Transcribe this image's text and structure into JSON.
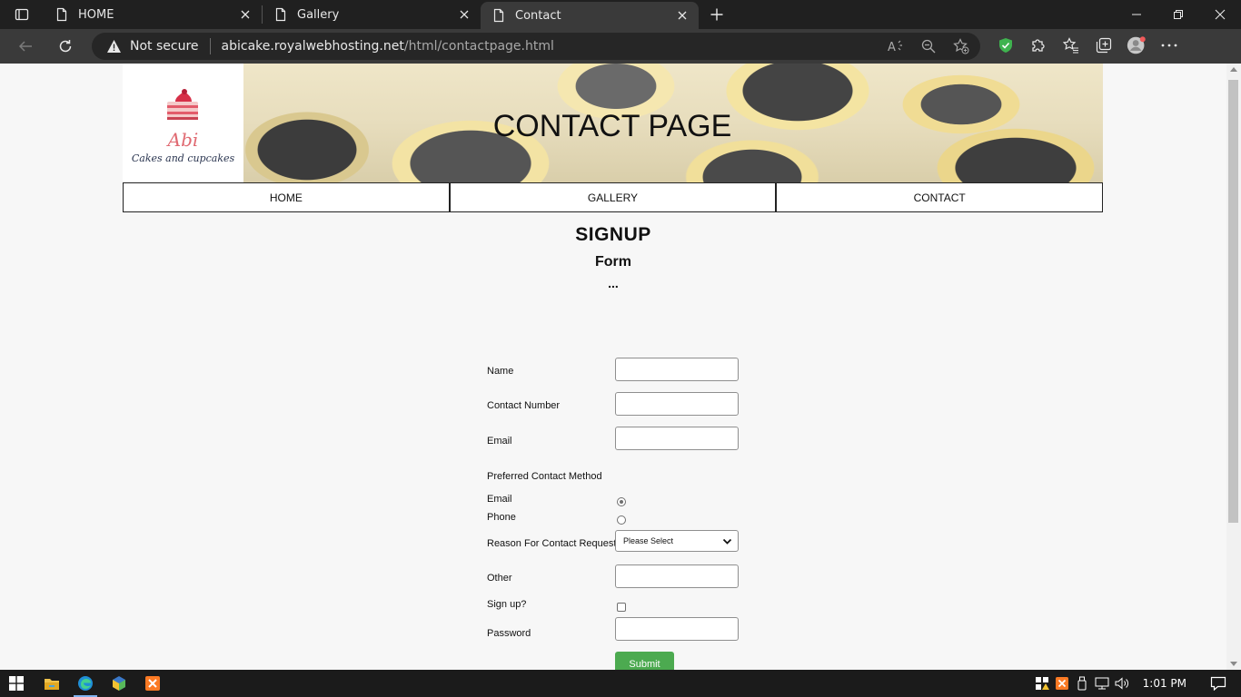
{
  "browser": {
    "tabs": [
      {
        "label": "HOME",
        "active": false
      },
      {
        "label": "Gallery",
        "active": false
      },
      {
        "label": "Contact",
        "active": true
      }
    ],
    "security_label": "Not secure",
    "url_domain": "abicake.royalwebhosting.net",
    "url_path": "/html/contactpage.html"
  },
  "site": {
    "logo_name": "Abi",
    "logo_tagline": "Cakes and cupcakes",
    "banner_title": "CONTACT PAGE",
    "menu": [
      "HOME",
      "GALLERY",
      "CONTACT"
    ]
  },
  "page": {
    "heading": "SIGNUP",
    "subheading": "Form",
    "dots": "...",
    "form": {
      "name_label": "Name",
      "contact_label": "Contact Number",
      "email_label": "Email",
      "preferred_label": "Preferred Contact Method",
      "method_email_label": "Email",
      "method_phone_label": "Phone",
      "method_selected": "Email",
      "reason_label": "Reason For Contact Request",
      "reason_selected": "Please Select",
      "other_label": "Other",
      "signup_label": "Sign up?",
      "password_label": "Password",
      "submit_label": "Submit"
    }
  },
  "taskbar": {
    "clock": "1:01 PM"
  },
  "colors": {
    "submit": "#4caa50",
    "tabbar": "#202020",
    "toolbar": "#3a3a3a"
  }
}
